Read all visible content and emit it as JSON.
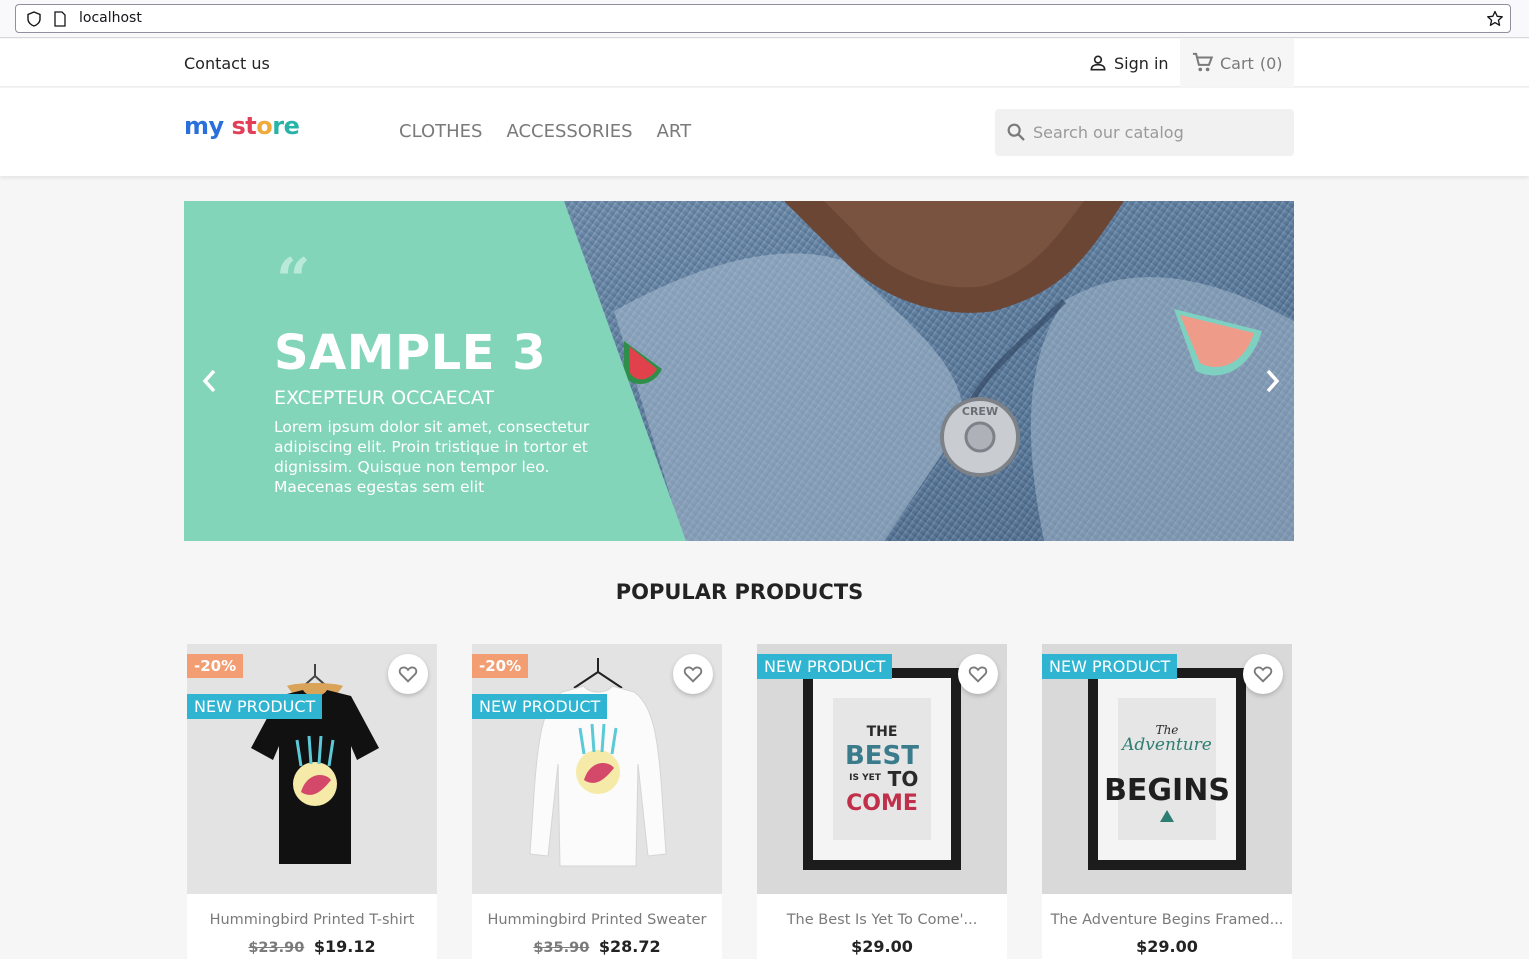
{
  "browser": {
    "url": "localhost"
  },
  "topnav": {
    "contact": "Contact us",
    "signin": "Sign in",
    "cart": "Cart",
    "cart_count": "(0)"
  },
  "header": {
    "logo": {
      "part1": "my",
      "part2": "st",
      "part3": "o",
      "part4": "re"
    },
    "menu": [
      "CLOTHES",
      "ACCESSORIES",
      "ART"
    ],
    "search_placeholder": "Search our catalog"
  },
  "slider": {
    "quote": "“",
    "title": "SAMPLE 3",
    "subtitle": "EXCEPTEUR OCCAECAT",
    "text": "Lorem ipsum dolor sit amet, consectetur adipiscing elit. Proin tristique in tortor et dignissim. Quisque non tempor leo. Maecenas egestas sem elit",
    "jacket_button_text": "CREW"
  },
  "popular": {
    "title": "POPULAR PRODUCTS",
    "products": [
      {
        "name": "Hummingbird Printed T-shirt",
        "old_price": "$23.90",
        "price": "$19.12",
        "discount": "-20%",
        "new_label": "NEW PRODUCT"
      },
      {
        "name": "Hummingbird Printed Sweater",
        "old_price": "$35.90",
        "price": "$28.72",
        "discount": "-20%",
        "new_label": "NEW PRODUCT"
      },
      {
        "name": "The Best Is Yet To Come'...",
        "price": "$29.00",
        "new_label": "NEW PRODUCT",
        "poster": {
          "top": "THE",
          "mid": "BEST",
          "small": "IS YET",
          "to": "TO",
          "bottom": "COME"
        }
      },
      {
        "name": "The Adventure Begins Framed...",
        "price": "$29.00",
        "new_label": "NEW PRODUCT",
        "poster": {
          "top": "The",
          "mid": "Adventure",
          "bottom": "BEGINS"
        }
      }
    ]
  },
  "colors": {
    "accent": "#2fb5d2",
    "discount": "#f39d72",
    "slider_panel": "#82d5b9"
  }
}
